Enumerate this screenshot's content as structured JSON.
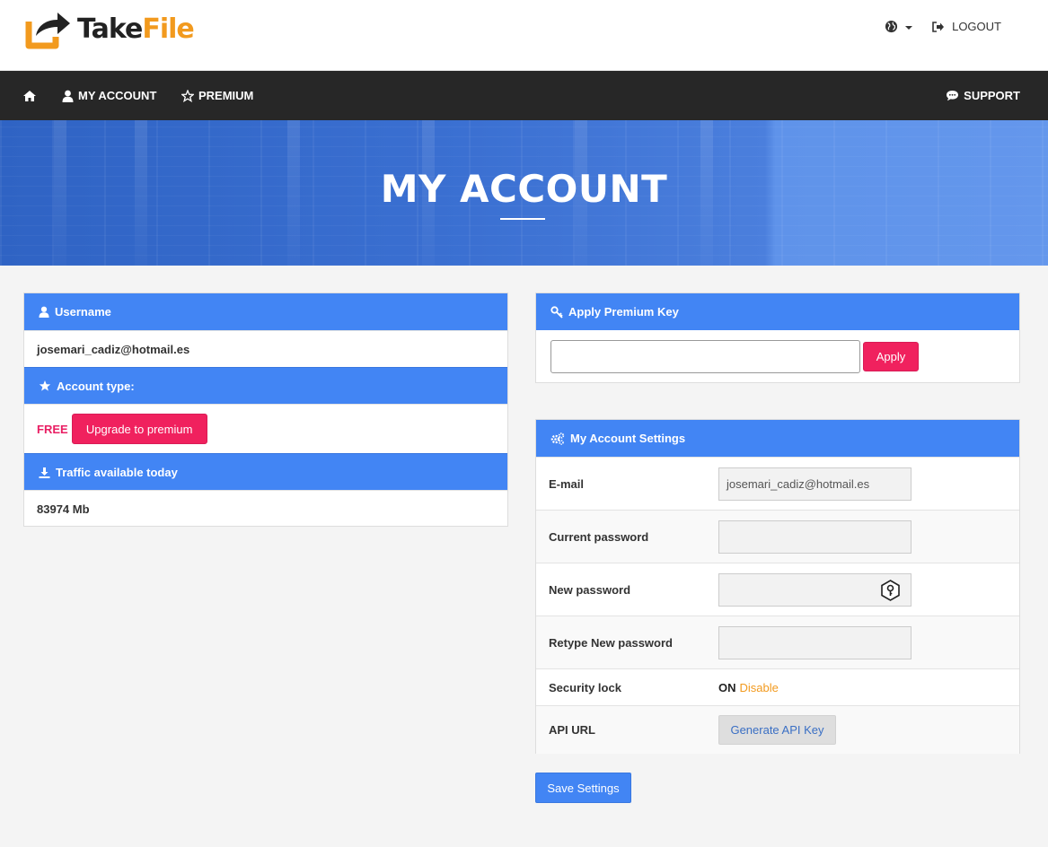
{
  "brand": {
    "name_part1": "Take",
    "name_part2": "File",
    "accent_color": "#f29a1e"
  },
  "header": {
    "logout_label": "LOGOUT"
  },
  "nav": {
    "my_account": "MY ACCOUNT",
    "premium": "PREMIUM",
    "support": "SUPPORT"
  },
  "hero": {
    "title": "MY ACCOUNT"
  },
  "account_panel": {
    "username_heading": "Username",
    "username_value": "josemari_cadiz@hotmail.es",
    "account_type_heading": "Account type:",
    "account_type_value": "FREE",
    "upgrade_button": "Upgrade to premium",
    "traffic_heading": "Traffic available today",
    "traffic_value": "83974 Mb"
  },
  "premium_key_panel": {
    "heading": "Apply Premium Key",
    "input_value": "",
    "apply_button": "Apply"
  },
  "settings_panel": {
    "heading": "My Account Settings",
    "email_label": "E-mail",
    "email_value": "josemari_cadiz@hotmail.es",
    "current_password_label": "Current password",
    "new_password_label": "New password",
    "retype_password_label": "Retype New password",
    "security_lock_label": "Security lock",
    "security_lock_state": "ON",
    "security_lock_action": "Disable",
    "api_url_label": "API URL",
    "api_button": "Generate API Key"
  },
  "save_button": "Save Settings",
  "colors": {
    "primary": "#4285f4",
    "pink": "#f0215e",
    "navbar": "#272727"
  }
}
